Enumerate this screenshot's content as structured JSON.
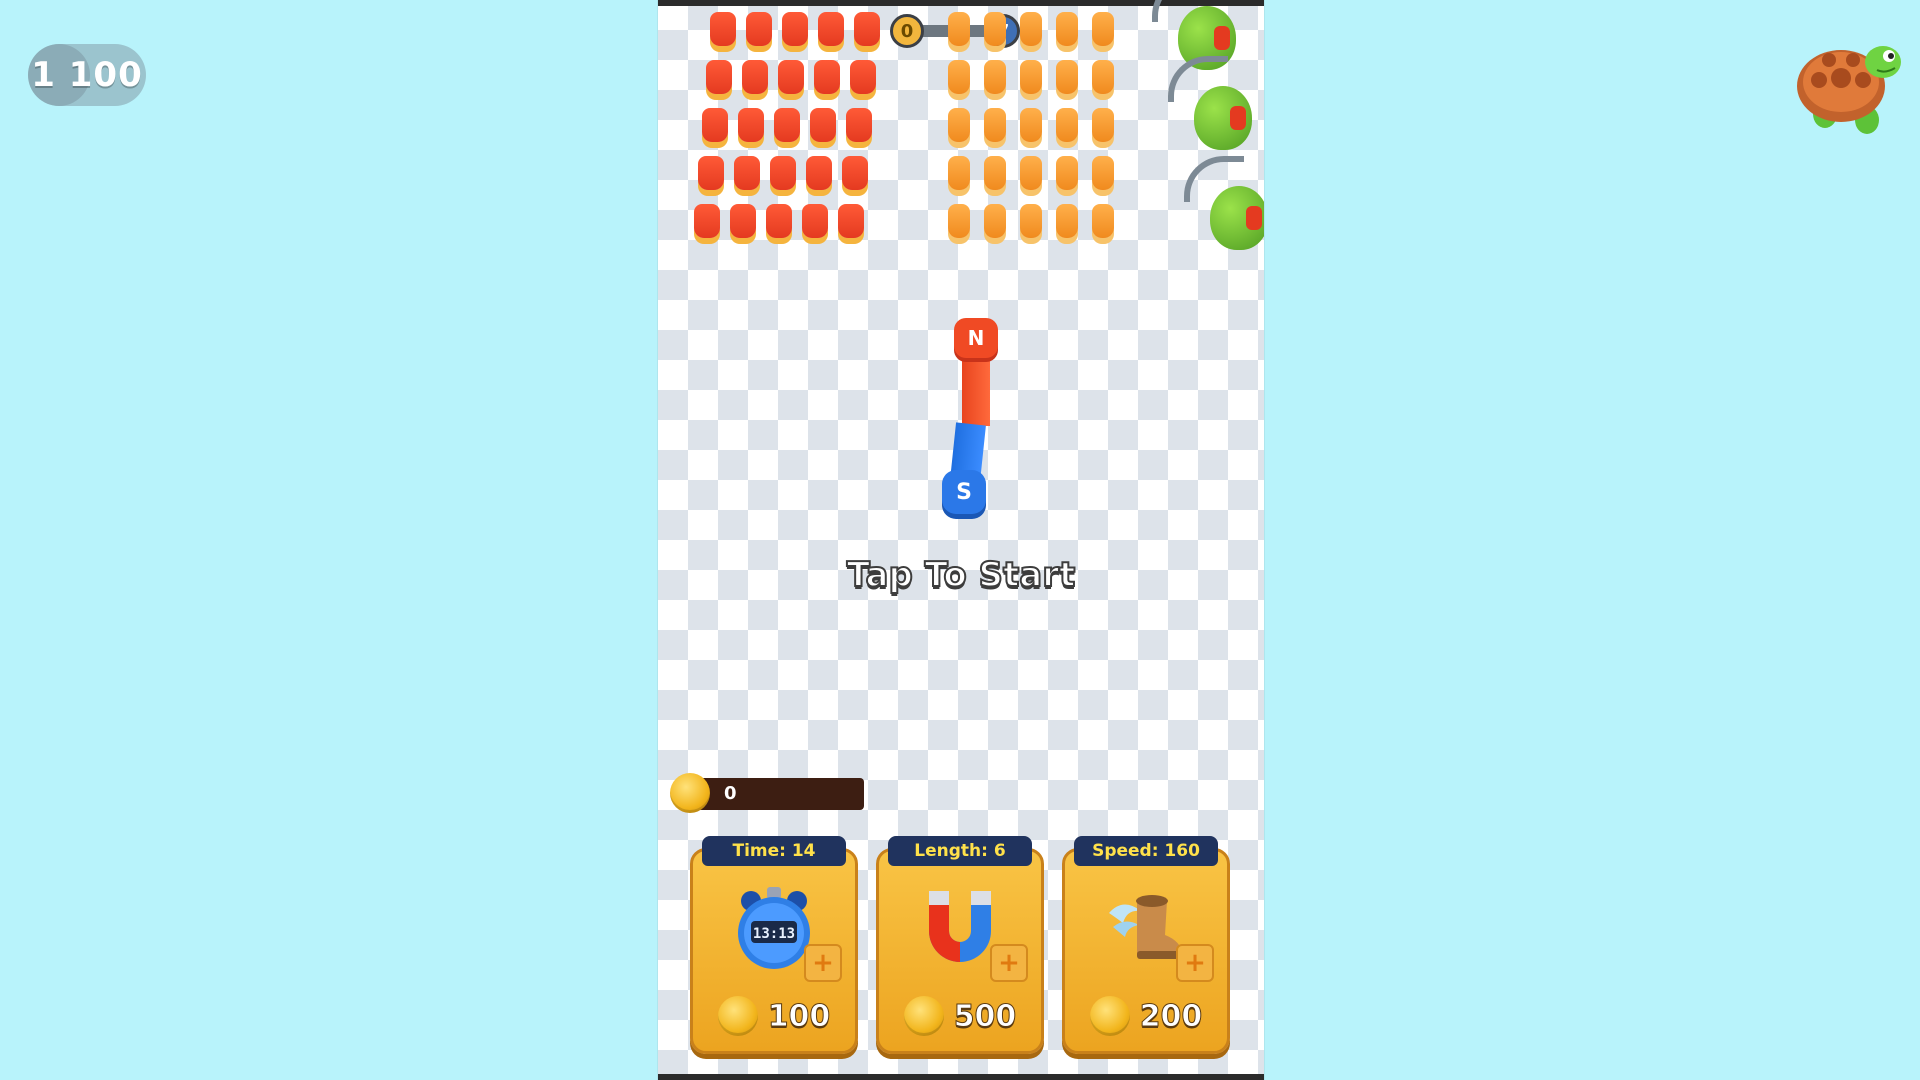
{
  "hud": {
    "counter": "1 100",
    "level_current": "0",
    "level_next": "7",
    "level_progress": 0.0
  },
  "board": {
    "prompt": "Tap To Start",
    "magnet": {
      "north_label": "N",
      "south_label": "S"
    }
  },
  "wallet": {
    "coins": "0"
  },
  "upgrades": [
    {
      "title": "Time: 14",
      "price": "100",
      "icon": "stopwatch-icon",
      "stopwatch_display": "13:13"
    },
    {
      "title": "Length: 6",
      "price": "500",
      "icon": "magnet-icon"
    },
    {
      "title": "Speed: 160",
      "price": "200",
      "icon": "winged-boot-icon"
    }
  ],
  "colors": {
    "background": "#b8f3fb",
    "card": "#f5b533",
    "card_header": "#20335e",
    "card_header_text": "#ffe14a",
    "magnet_north": "#f04a24",
    "magnet_south": "#2b78e8"
  }
}
